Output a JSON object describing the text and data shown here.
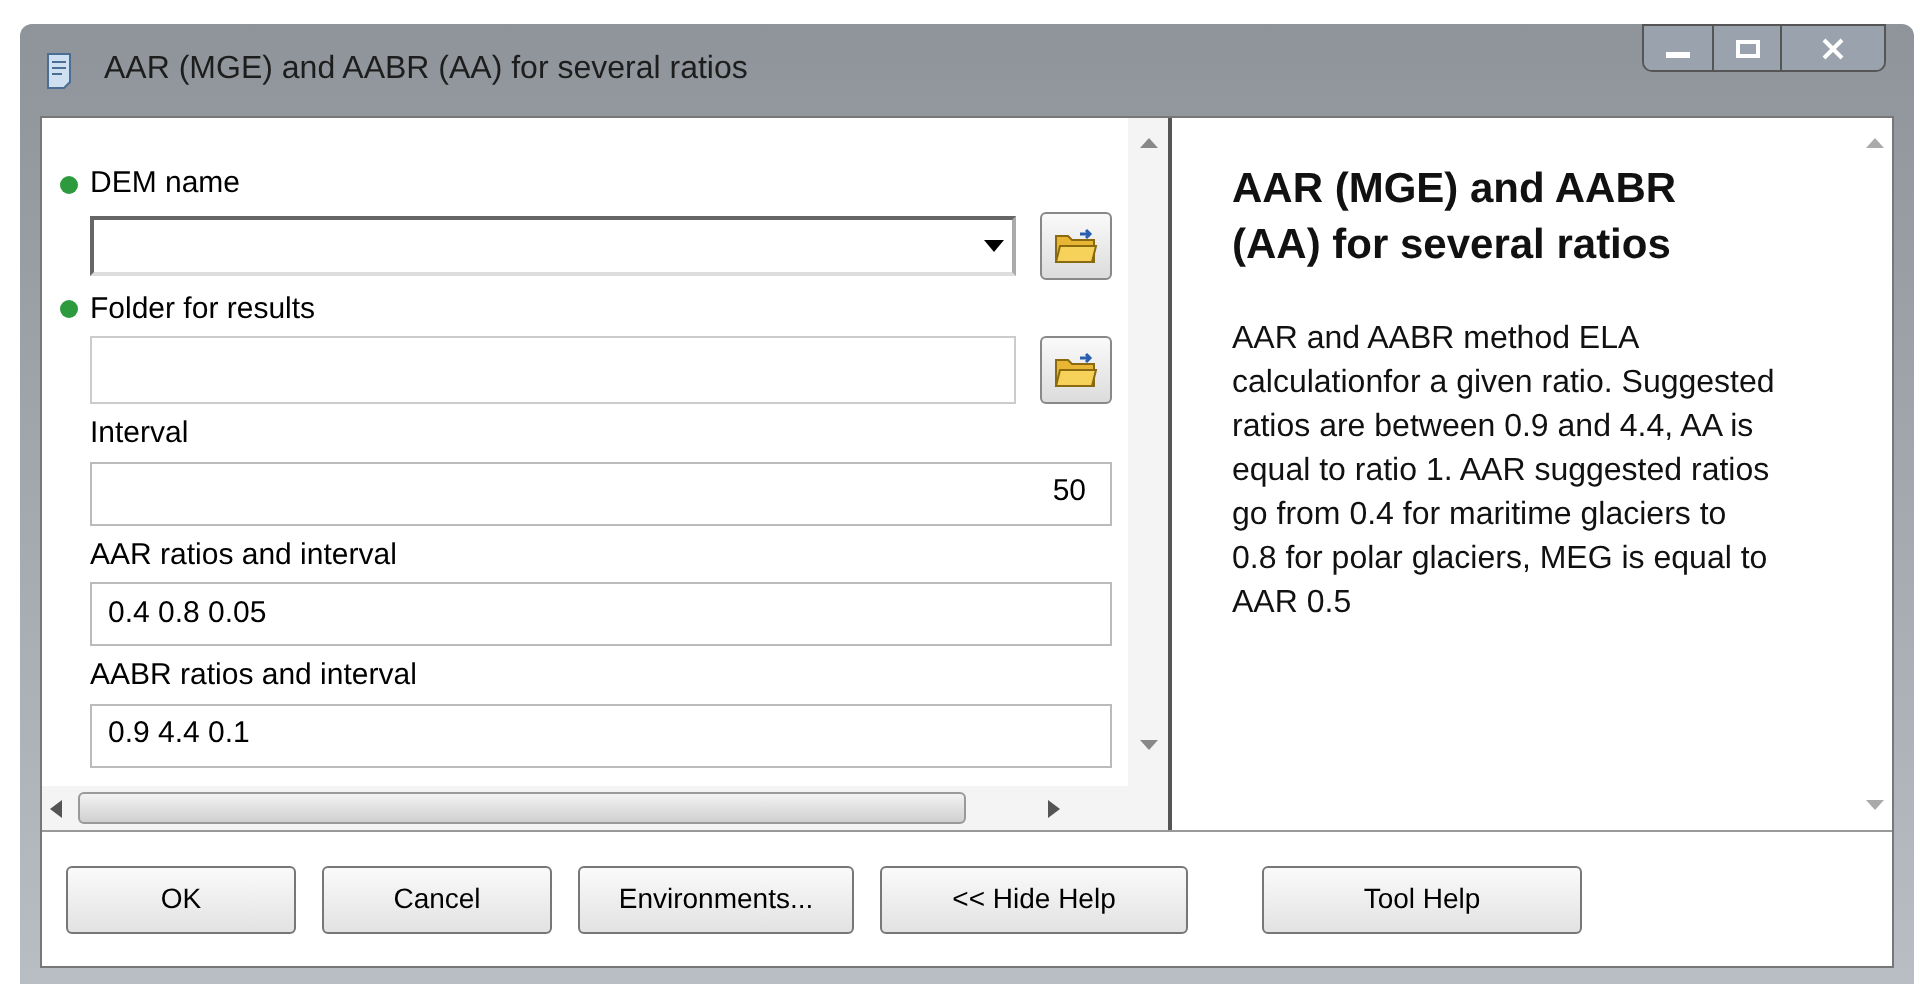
{
  "window": {
    "title": "AAR (MGE) and AABR (AA) for several ratios"
  },
  "parameters": [
    {
      "label": "DEM name",
      "required": true,
      "kind": "dropdown"
    },
    {
      "label": "Folder for results",
      "required": true,
      "kind": "path"
    },
    {
      "label": "Interval",
      "required": false,
      "kind": "number",
      "value": "50"
    },
    {
      "label": "AAR ratios and interval",
      "required": false,
      "kind": "text",
      "value": "0.4 0.8 0.05"
    },
    {
      "label": "AABR ratios and interval",
      "required": false,
      "kind": "text",
      "value": "0.9 4.4 0.1"
    }
  ],
  "help": {
    "title": "AAR (MGE) and AABR (AA) for several ratios",
    "body": "AAR and AABR method ELA calculationfor a given ratio. Suggested ratios are between 0.9 and 4.4, AA is equal to ratio 1. AAR suggested ratios go from 0.4 for maritime glaciers to 0.8 for polar glaciers, MEG is equal to AAR 0.5"
  },
  "buttons": [
    "OK",
    "Cancel",
    "Environments...",
    "<< Hide Help",
    "Tool Help"
  ]
}
